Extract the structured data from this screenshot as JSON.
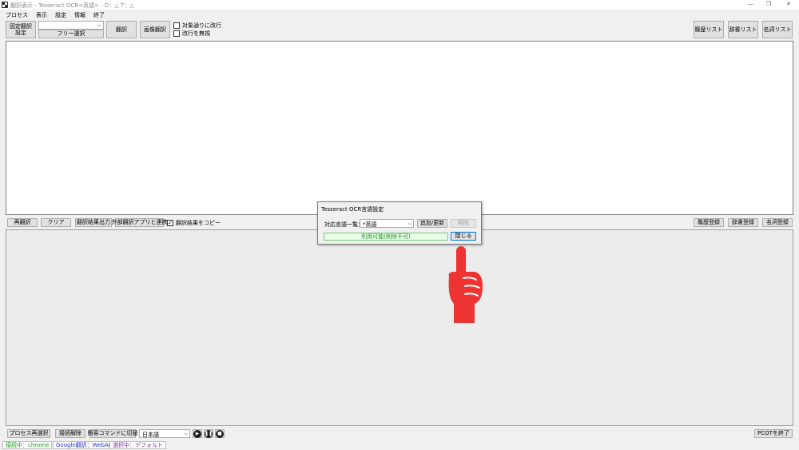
{
  "window": {
    "title": "翻訳表示 - Tesseract OCR<英語> - D：△ T：△",
    "controls": {
      "minimize": "—",
      "restore": "❐",
      "close": "✕"
    }
  },
  "menu": [
    "プロセス",
    "表示",
    "設定",
    "情報",
    "終了"
  ],
  "toolbar": {
    "fixed_area": "固定翻訳\n設定",
    "free_select": "フリー選択",
    "translate": "翻訳",
    "image_translate": "画像翻訳",
    "check_wrap": "対象通りに改行",
    "check_ignore_newline": "改行を無視",
    "history_list": "履歴リスト",
    "dict_list": "辞書リスト",
    "noun_list": "名詞リスト"
  },
  "middle_bar": {
    "retranslate": "再翻訳",
    "clear": "クリア",
    "output": "翻訳結果出力",
    "external": "外部翻訳アプリと連携",
    "copy_result": "翻訳結果をコピー",
    "history_register": "履歴登録",
    "dict_register": "辞書登録",
    "noun_register": "名詞登録"
  },
  "dialog": {
    "title": "Tesseract OCR言語設定",
    "lang_label": "対応言語一覧：",
    "lang_value": "*英語",
    "add_update": "追加/更新",
    "delete": "削除",
    "status": "利用可能(削除不可)",
    "close": "閉じる"
  },
  "bottom_bar": {
    "reselect_process": "プロセス再選択",
    "disconnect": "接続解除",
    "switch_simple": "簡易コマンドに切替",
    "language": "日本語",
    "play_icon": "play-icon",
    "pause_icon": "pause-icon",
    "stop_icon": "stop-icon",
    "exit_pcot": "PCOTを終了"
  },
  "status": {
    "connecting": "接続中：chrome",
    "google": "Google翻訳：WebAPI",
    "selected": "選択中：デフォルト"
  },
  "colors": {
    "accent_hand": "#ee3333",
    "status_green_bg": "#e6ffe6",
    "status_green_fg": "#2a8a2a",
    "status_connecting": "#1a9a1a",
    "status_google": "#2233cc",
    "status_selected": "#8a2aa8"
  }
}
